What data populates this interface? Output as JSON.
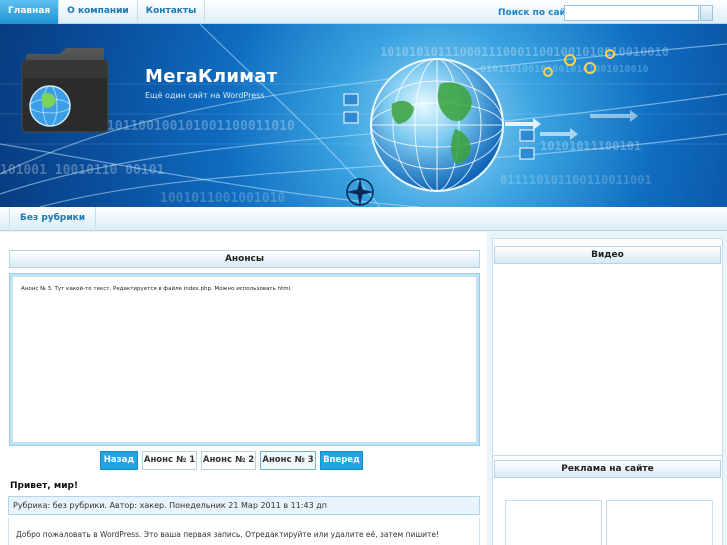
{
  "nav": {
    "items": [
      {
        "label": "Главная",
        "active": true
      },
      {
        "label": "О компании",
        "active": false
      },
      {
        "label": "Контакты",
        "active": false
      }
    ]
  },
  "search": {
    "label": "Поиск по сайту",
    "value": ""
  },
  "header": {
    "site_title": "МегаКлимат",
    "tagline": "Ещё один сайт на WordPress"
  },
  "categories": [
    {
      "label": "Без рубрики"
    }
  ],
  "announcements": {
    "title": "Анонсы",
    "text": "Анонс № 3. Тут какой-то текст. Редактируется в файле index.php. Можно использовать html.",
    "prev_label": "Назад",
    "next_label": "Вперед",
    "items": [
      {
        "label": "Анонс № 1",
        "current": false
      },
      {
        "label": "Анонс № 2",
        "current": false
      },
      {
        "label": "Анонс № 3",
        "current": true
      }
    ]
  },
  "post": {
    "title": "Привет, мир!",
    "meta": "Рубрика: без рубрики. Автор: хакер. Понедельник 21 Мар 2011 в 11:43 дп",
    "excerpt": "Добро пожаловать в WordPress. Это ваша первая запись. Отредактируйте или удалите её, затем пишите!"
  },
  "sidebar": {
    "video_title": "Видео",
    "ads_title": "Реклама на сайте"
  },
  "colors": {
    "accent": "#1e93d3",
    "link": "#1a78b5",
    "pager_nav": "#21a4e0",
    "header_bg": "#0f6cc0"
  },
  "icons": {
    "folder_globe": "folder-globe-icon",
    "earth": "earth-globe-illustration",
    "compass": "compass-icon"
  }
}
